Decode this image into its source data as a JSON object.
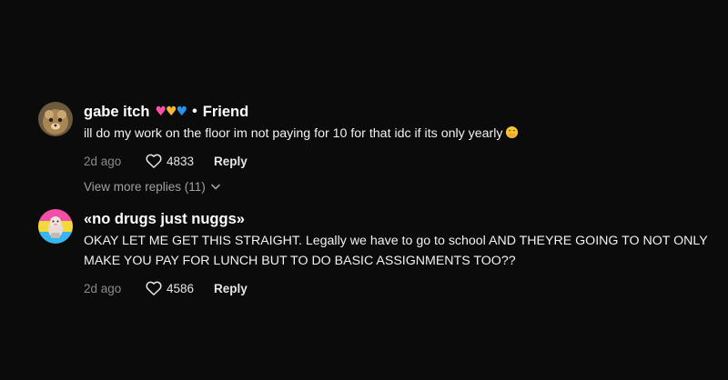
{
  "comments": [
    {
      "username": "gabe itch",
      "badge_separator": "•",
      "badge": "Friend",
      "text": "ill do my work on the floor im not paying for 10 for that idc if its only yearly",
      "age": "2d ago",
      "likes": "4833",
      "reply_label": "Reply",
      "emoji_icon": "hand-over-mouth-emoji",
      "name_hearts": [
        "pink-heart",
        "yellow-heart",
        "blue-heart"
      ]
    },
    {
      "username": "«no drugs just nuggs»",
      "text": "OKAY LET ME GET THIS STRAIGHT. Legally we have to go to school AND THEYRE GOING TO NOT ONLY MAKE YOU PAY FOR LUNCH BUT TO DO BASIC ASSIGNMENTS TOO??",
      "age": "2d ago",
      "likes": "4586",
      "reply_label": "Reply"
    }
  ],
  "view_more_replies": "View more replies (11)",
  "colors": {
    "background": "#0b0b0b",
    "text_primary": "#ffffff",
    "text_secondary": "#8a8a8a",
    "heart_pink": "#ff4fa8",
    "heart_yellow": "#f5b82e",
    "heart_blue": "#2b8ff0"
  }
}
